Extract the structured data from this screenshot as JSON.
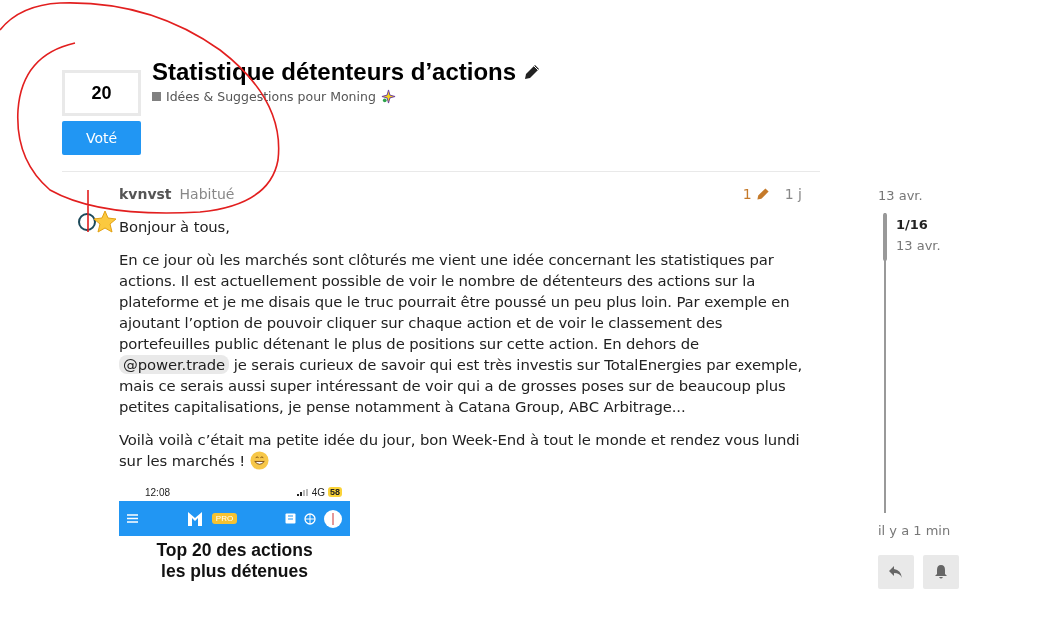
{
  "vote": {
    "count": "20",
    "button": "Voté"
  },
  "topic": {
    "title": "Statistique détenteurs d’actions",
    "category": "Idées & Suggestions pour Moning"
  },
  "post": {
    "username": "kvnvst",
    "user_title": "Habitué",
    "edits": "1",
    "age": "1 j",
    "paragraphs": [
      {
        "kind": "text",
        "text": "Bonjour à tous,"
      },
      {
        "kind": "mention",
        "before": "En ce jour où les marchés sont clôturés me vient une idée concernant les statistiques par actions. Il est actuellement possible de voir le nombre de détenteurs des actions sur la plateforme et je me disais que le truc pourrait être poussé un peu plus loin. Par exemple en ajoutant l’option de pouvoir cliquer sur chaque action et de voir le classement des portefeuilles public détenant le plus de positions sur cette action. En dehors de",
        "mention": "@power.trade",
        "after": "je serais curieux de savoir qui est très investis sur TotalEnergies par exemple, mais ce serais aussi super intéressant de voir qui a de grosses poses sur de beaucoup plus petites capitalisations, je pense notamment à Catana Group, ABC Arbitrage..."
      },
      {
        "kind": "emoji",
        "text": "Voilà voilà c’était ma petite idée du jour, bon Week-End à tout le monde et rendez vous lundi sur les marchés !"
      }
    ],
    "image": {
      "time": "12:08",
      "network": "4G",
      "battery": "58",
      "badge": "PRO",
      "heading_1": "Top 20 des actions",
      "heading_2": "les plus détenues"
    }
  },
  "timeline": {
    "start_date": "13 avr.",
    "position": "1/16",
    "position_date": "13 avr.",
    "end_label": "il y a 1 min",
    "level": 0.16
  }
}
